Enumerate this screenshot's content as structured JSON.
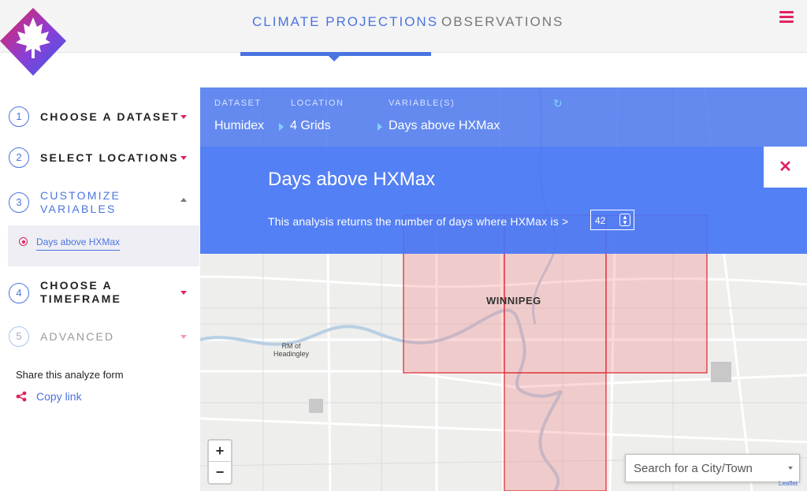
{
  "header": {
    "tabs": [
      {
        "label": "CLIMATE PROJECTIONS",
        "active": true
      },
      {
        "label": "OBSERVATIONS",
        "active": false
      }
    ],
    "menu_icon": "hamburger-icon",
    "accent_color": "#4a74e0",
    "brand_color": "#e0245e"
  },
  "sidebar": {
    "steps": [
      {
        "number": "1",
        "label": "CHOOSE A DATASET",
        "state": "collapsed"
      },
      {
        "number": "2",
        "label": "SELECT LOCATIONS",
        "state": "collapsed"
      },
      {
        "number": "3",
        "label_line1": "CUSTOMIZE",
        "label_line2": "VARIABLES",
        "state": "expanded"
      },
      {
        "number": "4",
        "label_line1": "CHOOSE A",
        "label_line2": "TIMEFRAME",
        "state": "collapsed"
      },
      {
        "number": "5",
        "label": "ADVANCED",
        "state": "disabled"
      }
    ],
    "selected_variable": "Days above HXMax",
    "share_title": "Share this analyze form",
    "copy_link": "Copy link"
  },
  "info_bar": {
    "dataset_label": "DATASET",
    "dataset_value": "Humidex",
    "location_label": "LOCATION",
    "location_value": "4 Grids",
    "variable_label": "VARIABLE(S)",
    "variable_value": "Days above HXMax"
  },
  "detail": {
    "title": "Days above HXMax",
    "description": "This analysis returns the number of days where HXMax is >",
    "threshold_value": "42",
    "close_icon": "close-icon"
  },
  "map": {
    "city_label": "WINNIPEG",
    "place_label_line1": "RM of",
    "place_label_line2": "Headingley",
    "zoom_in": "+",
    "zoom_out": "−",
    "search_placeholder": "Search for a City/Town",
    "attribution": "Leaflet"
  }
}
